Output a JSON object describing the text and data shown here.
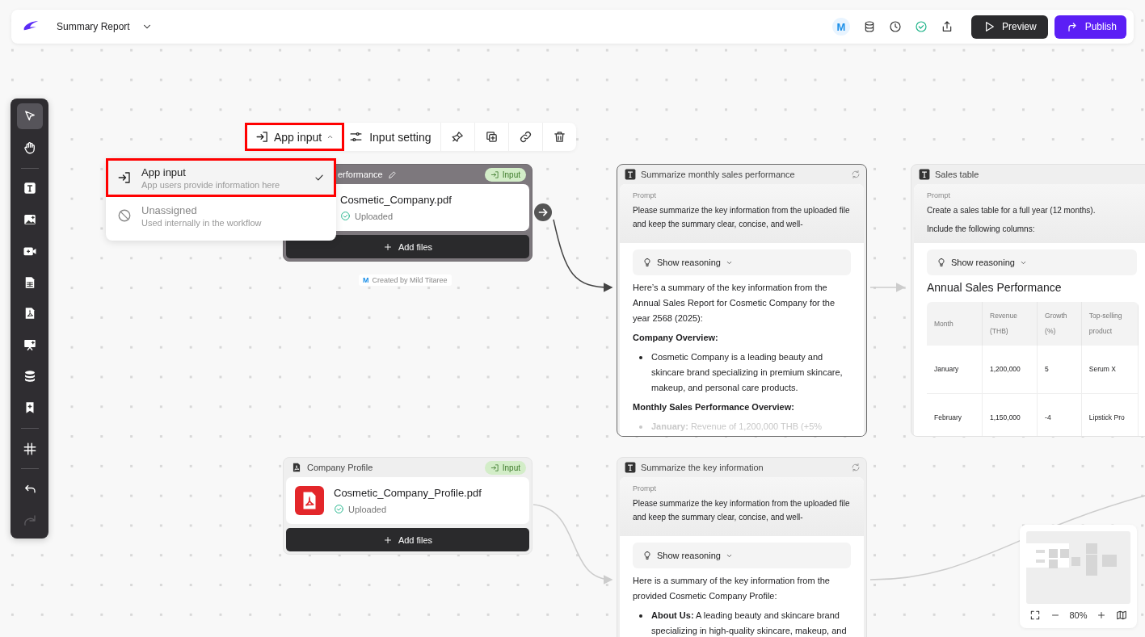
{
  "header": {
    "title": "Summary Report",
    "avatar": "M",
    "preview": "Preview",
    "publish": "Publish"
  },
  "tool_groups": [
    {
      "tools": [
        {
          "kind": "pointer",
          "selected": true
        },
        {
          "kind": "hand",
          "selected": false
        }
      ]
    },
    {
      "tools": [
        {
          "kind": "text",
          "selected": false
        },
        {
          "kind": "image",
          "selected": false
        },
        {
          "kind": "video",
          "selected": false
        },
        {
          "kind": "sheet",
          "selected": false
        },
        {
          "kind": "pdf",
          "selected": false
        },
        {
          "kind": "slides",
          "selected": false
        },
        {
          "kind": "database",
          "selected": false
        },
        {
          "kind": "bookmark",
          "selected": false
        }
      ]
    },
    {
      "tools": [
        {
          "kind": "grid",
          "selected": false
        }
      ]
    },
    {
      "tools": [
        {
          "kind": "undo",
          "selected": false,
          "disabled": false
        },
        {
          "kind": "redo",
          "selected": false,
          "disabled": true
        }
      ]
    }
  ],
  "node_toolbar": {
    "mode": {
      "label": "App input",
      "expanded": true,
      "highlighted": true
    },
    "setting": "Input setting"
  },
  "mode_menu": [
    {
      "title": "App input",
      "subtitle": "App users provide information here",
      "selected": true,
      "highlighted": true
    },
    {
      "title": "Unassigned",
      "subtitle": "Used internally in the workflow",
      "selected": false,
      "highlighted": false
    }
  ],
  "file_nodes": [
    {
      "title": "erformance",
      "editable": true,
      "badge": "Input",
      "file": "Cosmetic_Company.pdf",
      "status": "Uploaded",
      "add": "Add files",
      "focused": true,
      "creator": {
        "avatar": "M",
        "text": "Created by Mild Titaree"
      }
    },
    {
      "title": "Company Profile",
      "editable": false,
      "badge": "Input",
      "file": "Cosmetic_Company_Profile.pdf",
      "status": "Uploaded",
      "add": "Add files",
      "focused": false
    }
  ],
  "text_nodes": [
    {
      "title": "Summarize monthly sales performance",
      "refresh": true,
      "selected": true,
      "prompt_label": "Prompt",
      "prompt": [
        "Please summarize the key information from the uploaded file and keep the summary clear, concise, and well-"
      ],
      "reasoning": "Show reasoning",
      "output": [
        {
          "kind": "para",
          "text": "Here’s a summary of the key information from the Annual Sales Report for Cosmetic Company for the year 2568 (2025):"
        },
        {
          "kind": "heading",
          "text": "Company Overview:"
        },
        {
          "kind": "bullet",
          "text": "Cosmetic Company is a leading beauty and skincare brand specializing in premium skincare, makeup, and personal care products."
        },
        {
          "kind": "heading",
          "text": "Monthly Sales Performance Overview:"
        },
        {
          "kind": "faded",
          "text": "**January:** Revenue of 1,200,000 THB (+5%"
        }
      ]
    },
    {
      "title": "Sales table",
      "refresh": false,
      "selected": false,
      "prompt_label": "Prompt",
      "prompt": [
        "Create a sales table for a full year (12 months).",
        "Include the following columns:"
      ],
      "reasoning": "Show reasoning",
      "output": [
        {
          "kind": "title",
          "text": "Annual Sales Performance"
        },
        {
          "kind": "table",
          "columns": [
            "Month",
            "Revenue (THB)",
            "Growth (%)",
            "Top-selling product"
          ],
          "rows": [
            [
              "January",
              "1,200,000",
              "5",
              "Serum X"
            ],
            [
              "February",
              "1,150,000",
              "-4",
              "Lipstick Pro"
            ]
          ]
        }
      ]
    },
    {
      "title": "Summarize the key information",
      "refresh": true,
      "selected": false,
      "prompt_label": "Prompt",
      "prompt": [
        "Please summarize the key information from the uploaded file and keep the summary clear, concise, and well-"
      ],
      "reasoning": "Show reasoning",
      "output": [
        {
          "kind": "para",
          "text": "Here is a summary of the key information from the provided Cosmetic Company Profile:"
        },
        {
          "kind": "bullet",
          "text": "**About Us:** A leading beauty and skincare brand specializing in high-quality skincare, makeup, and"
        }
      ]
    }
  ],
  "minimap": {
    "zoom": "80%"
  }
}
